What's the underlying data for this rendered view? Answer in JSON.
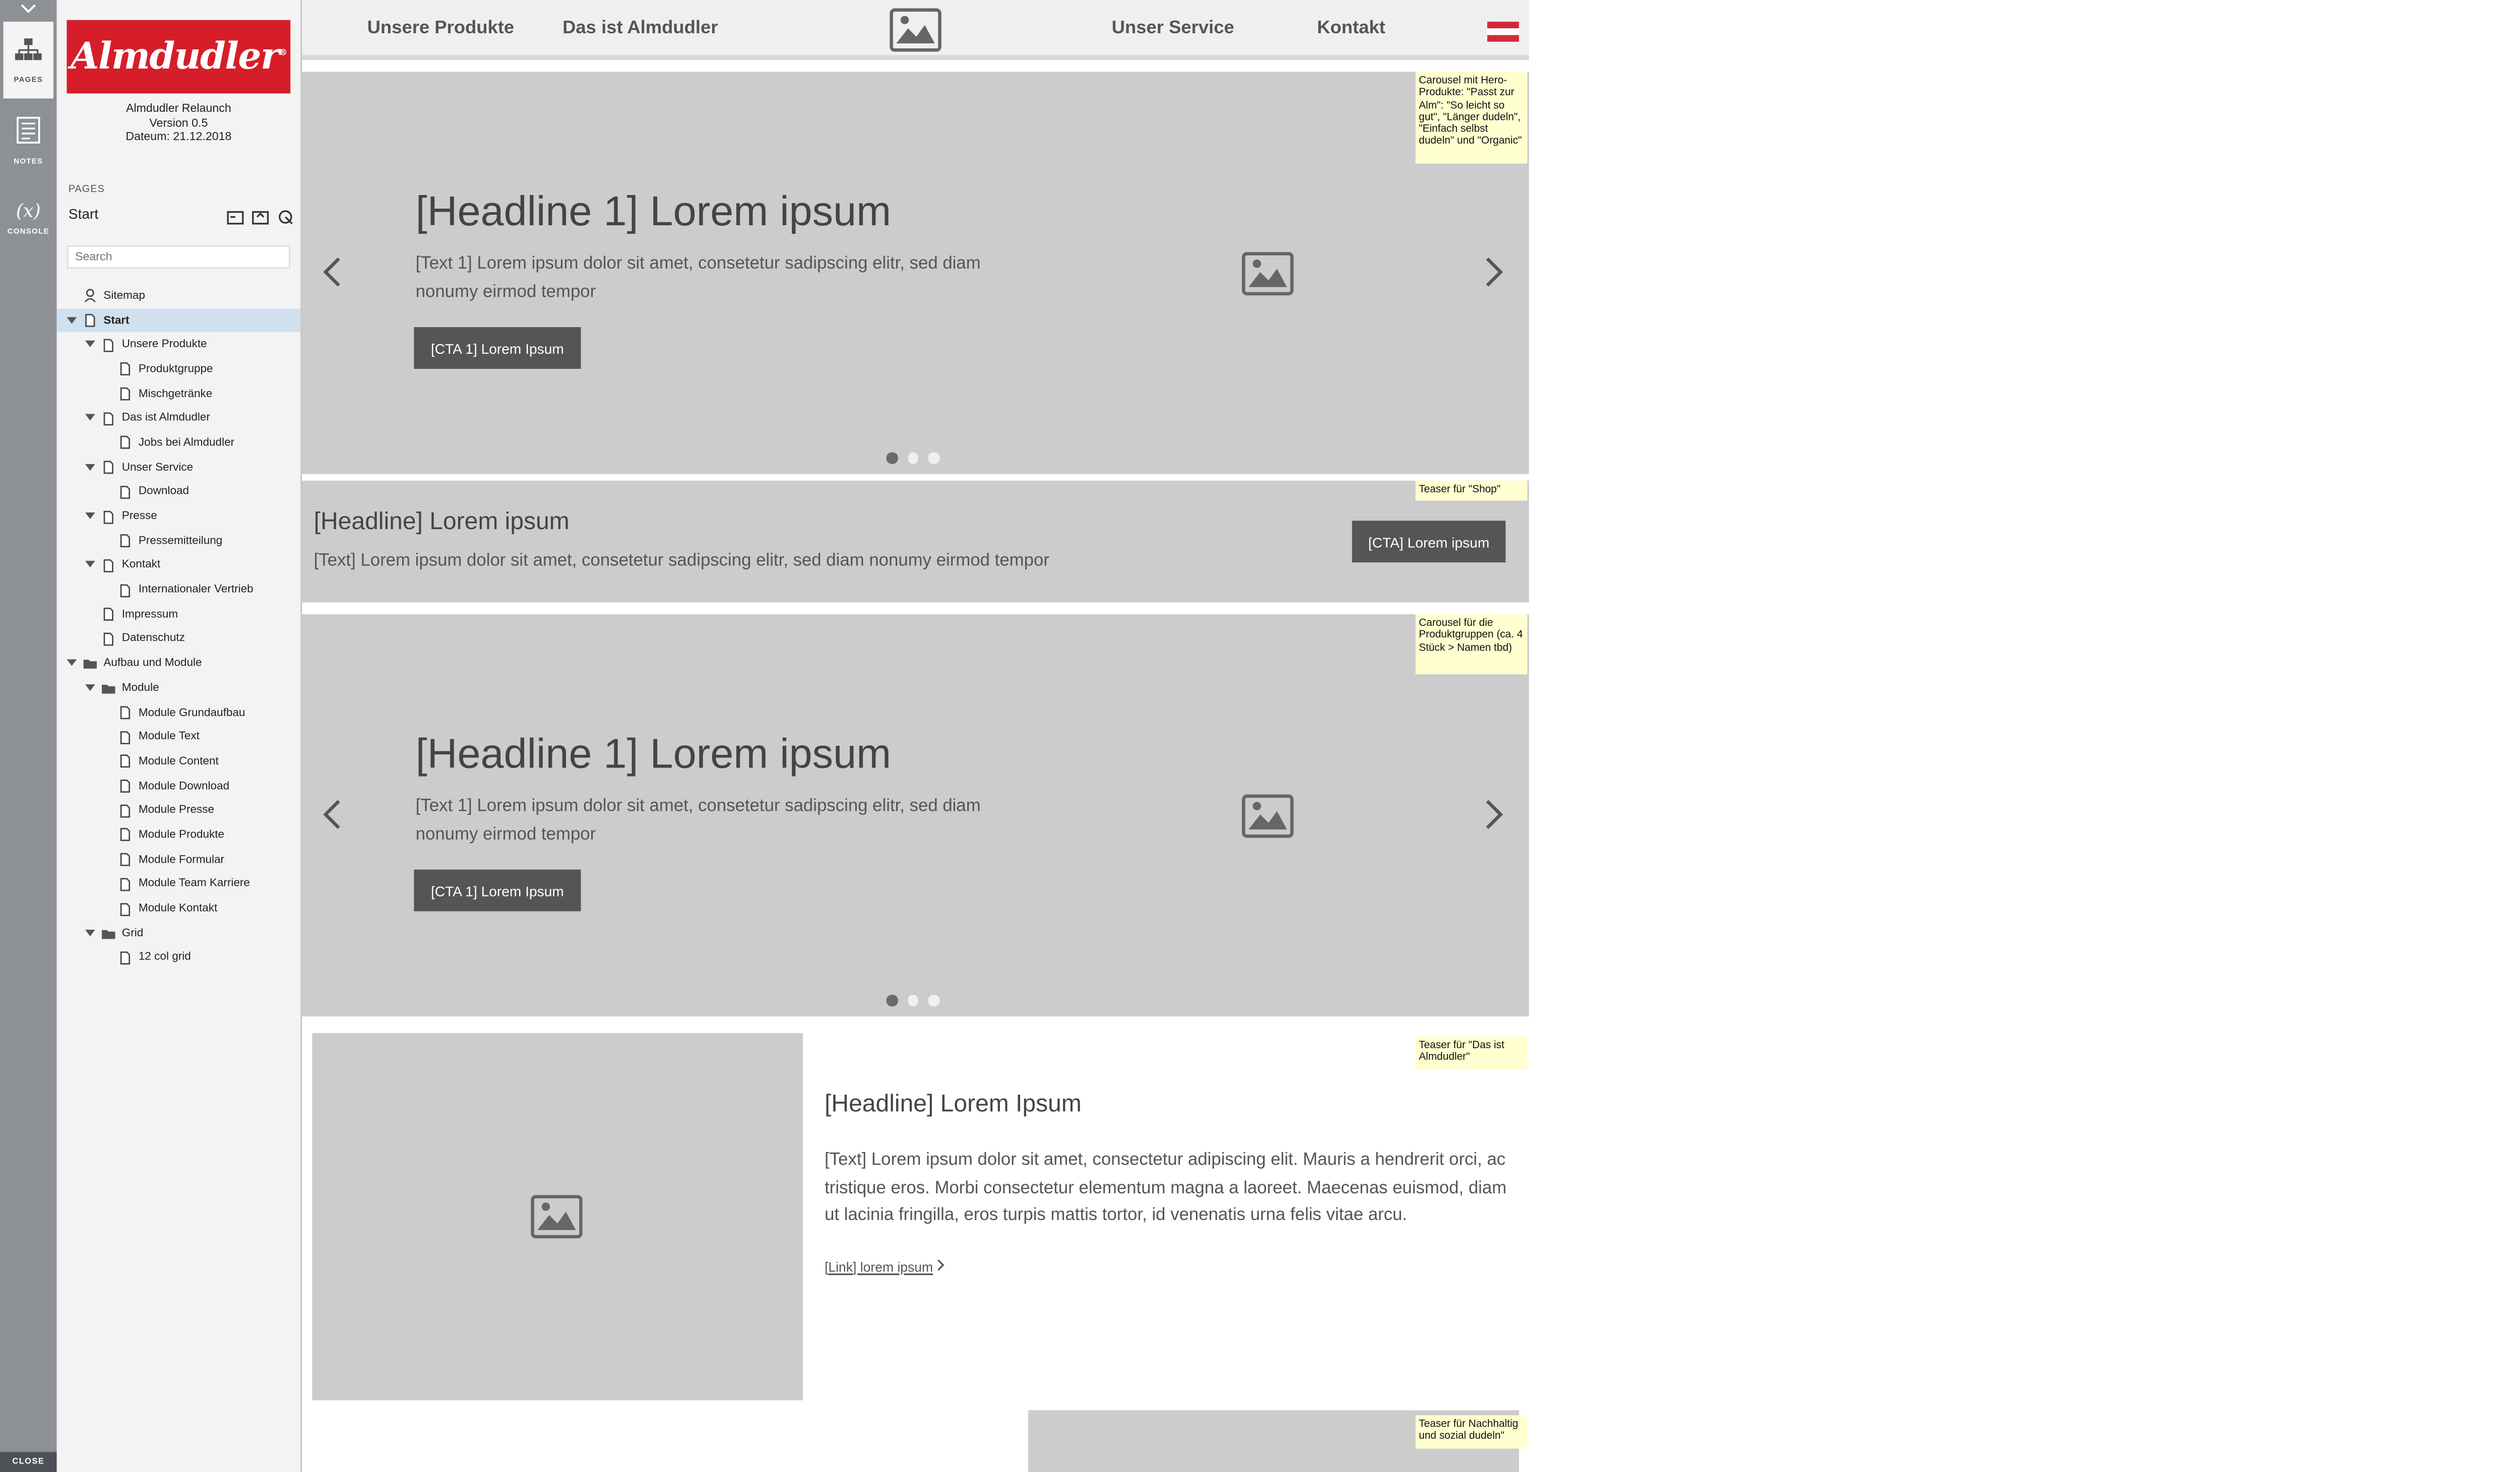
{
  "rail": {
    "pages_label": "PAGES",
    "notes_label": "NOTES",
    "console_label": "CONSOLE",
    "close_label": "CLOSE"
  },
  "project": {
    "logo_text": "Almdudler",
    "logo_reg": "®",
    "title": "Almdudler Relaunch",
    "version": "Version 0.5",
    "date": "Dateum: 21.12.2018"
  },
  "pages_panel": {
    "section_label": "PAGES",
    "current_page": "Start",
    "search_placeholder": "Search",
    "tree": [
      {
        "label": "Sitemap",
        "icon": "sitemap-icon",
        "level": 1,
        "toggle": false,
        "selected": false
      },
      {
        "label": "Start",
        "icon": "page-icon",
        "level": 1,
        "toggle": true,
        "selected": true
      },
      {
        "label": "Unsere Produkte",
        "icon": "page-icon",
        "level": 2,
        "toggle": true,
        "selected": false
      },
      {
        "label": "Produktgruppe",
        "icon": "page-icon",
        "level": 3,
        "toggle": false,
        "selected": false
      },
      {
        "label": "Mischgetränke",
        "icon": "page-icon",
        "level": 3,
        "toggle": false,
        "selected": false
      },
      {
        "label": "Das ist Almdudler",
        "icon": "page-icon",
        "level": 2,
        "toggle": true,
        "selected": false
      },
      {
        "label": "Jobs bei Almdudler",
        "icon": "page-icon",
        "level": 3,
        "toggle": false,
        "selected": false
      },
      {
        "label": "Unser Service",
        "icon": "page-icon",
        "level": 2,
        "toggle": true,
        "selected": false
      },
      {
        "label": "Download",
        "icon": "page-icon",
        "level": 3,
        "toggle": false,
        "selected": false
      },
      {
        "label": "Presse",
        "icon": "page-icon",
        "level": 2,
        "toggle": true,
        "selected": false
      },
      {
        "label": "Pressemitteilung",
        "icon": "page-icon",
        "level": 3,
        "toggle": false,
        "selected": false
      },
      {
        "label": "Kontakt",
        "icon": "page-icon",
        "level": 2,
        "toggle": true,
        "selected": false
      },
      {
        "label": "Internationaler Vertrieb",
        "icon": "page-icon",
        "level": 3,
        "toggle": false,
        "selected": false
      },
      {
        "label": "Impressum",
        "icon": "page-icon",
        "level": 2,
        "toggle": false,
        "selected": false
      },
      {
        "label": "Datenschutz",
        "icon": "page-icon",
        "level": 2,
        "toggle": false,
        "selected": false
      },
      {
        "label": "Aufbau und Module",
        "icon": "folder-icon",
        "level": 1,
        "toggle": true,
        "selected": false
      },
      {
        "label": "Module",
        "icon": "folder-icon",
        "level": 2,
        "toggle": true,
        "selected": false
      },
      {
        "label": "Module Grundaufbau",
        "icon": "page-icon",
        "level": 3,
        "toggle": false,
        "selected": false
      },
      {
        "label": "Module Text",
        "icon": "page-icon",
        "level": 3,
        "toggle": false,
        "selected": false
      },
      {
        "label": "Module Content",
        "icon": "page-icon",
        "level": 3,
        "toggle": false,
        "selected": false
      },
      {
        "label": "Module Download",
        "icon": "page-icon",
        "level": 3,
        "toggle": false,
        "selected": false
      },
      {
        "label": "Module Presse",
        "icon": "page-icon",
        "level": 3,
        "toggle": false,
        "selected": false
      },
      {
        "label": "Module Produkte",
        "icon": "page-icon",
        "level": 3,
        "toggle": false,
        "selected": false
      },
      {
        "label": "Module Formular",
        "icon": "page-icon",
        "level": 3,
        "toggle": false,
        "selected": false
      },
      {
        "label": "Module Team Karriere",
        "icon": "page-icon",
        "level": 3,
        "toggle": false,
        "selected": false
      },
      {
        "label": "Module Kontakt",
        "icon": "page-icon",
        "level": 3,
        "toggle": false,
        "selected": false
      },
      {
        "label": "Grid",
        "icon": "folder-icon",
        "level": 2,
        "toggle": true,
        "selected": false
      },
      {
        "label": "12 col grid",
        "icon": "page-icon",
        "level": 3,
        "toggle": false,
        "selected": false
      }
    ]
  },
  "topnav": {
    "items": [
      "Unsere Produkte",
      "Das ist Almdudler",
      "Unser Service",
      "Kontakt"
    ]
  },
  "hero1": {
    "headline": "[Headline 1] Lorem ipsum",
    "text": "[Text 1] Lorem ipsum dolor sit amet, consetetur sadipscing elitr, sed diam nonumy eirmod tempor",
    "cta": "[CTA 1] Lorem Ipsum",
    "active_dot": 1,
    "dot_count": 3
  },
  "teaser_shop": {
    "headline": "[Headline] Lorem ipsum",
    "text": "[Text] Lorem ipsum dolor sit amet, consetetur sadipscing elitr, sed diam nonumy eirmod tempor",
    "cta": "[CTA] Lorem ipsum"
  },
  "hero2": {
    "headline": "[Headline 1] Lorem ipsum",
    "text": "[Text 1] Lorem ipsum dolor sit amet, consetetur sadipscing elitr, sed diam nonumy eirmod tempor",
    "cta": "[CTA 1] Lorem Ipsum",
    "active_dot": 1,
    "dot_count": 3
  },
  "teaser_das": {
    "headline": "[Headline] Lorem Ipsum",
    "text": "[Text] Lorem ipsum dolor sit amet, consectetur adipiscing elit. Mauris a hendrerit orci, ac tristique eros. Morbi consectetur elementum magna a laoreet. Maecenas euismod, diam ut lacinia fringilla, eros turpis mattis tortor, id venenatis urna felis vitae arcu.",
    "link": "[Link] lorem ipsum"
  },
  "notes": {
    "hero": "Carousel  mit Hero-Produkte: \"Passt zur Alm\": \"So leicht so gut\", \"Länger dudeln\", \"Einfach selbst dudeln\" und \"Organic\"",
    "shop": "Teaser für \"Shop\"",
    "products": "Carousel für die Produktgruppen (ca. 4 Stück > Namen tbd)",
    "das_ist": "Teaser für \"Das ist Almdudler\"",
    "nachhaltig": "Teaser für Nachhaltig und sozial dudeln\""
  },
  "colors": {
    "brand_red": "#d61e2a",
    "rail_grey": "#8d9196",
    "placeholder_grey": "#cccccc",
    "button_dark": "#555555",
    "note_yellow": "#ffffd0",
    "selection_blue": "#cfe0ee"
  }
}
